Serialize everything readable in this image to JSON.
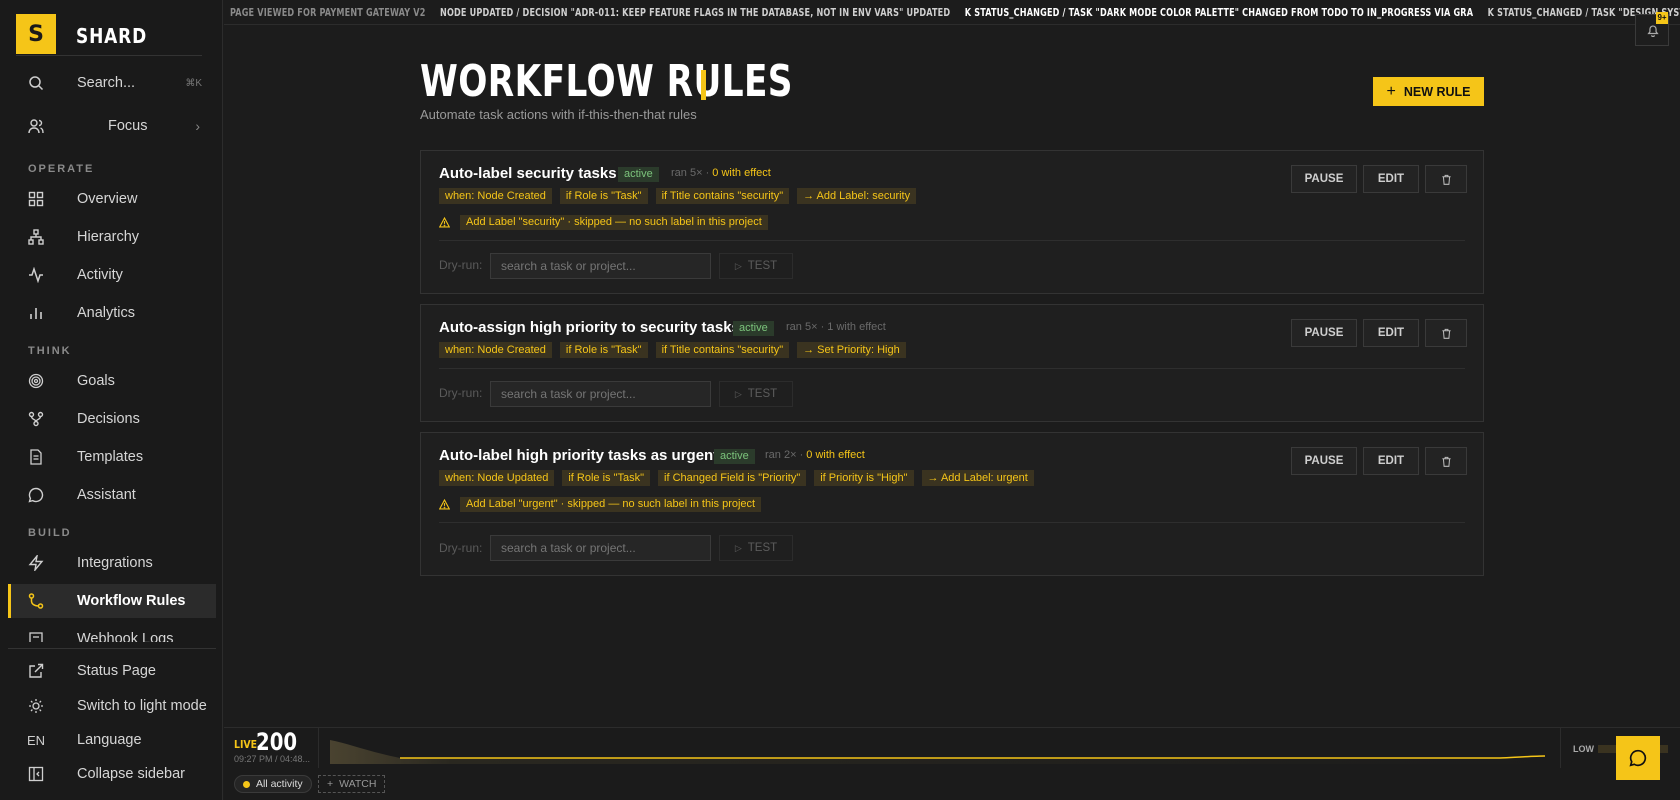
{
  "app": {
    "logo_letter": "S",
    "name": "SHARD"
  },
  "sidebar": {
    "search": {
      "label": "Search...",
      "shortcut": "⌘K"
    },
    "focus": {
      "label": "Focus"
    },
    "sections": {
      "operate": "OPERATE",
      "think": "THINK",
      "build": "BUILD"
    },
    "items": [
      {
        "label": "Overview"
      },
      {
        "label": "Hierarchy"
      },
      {
        "label": "Activity"
      },
      {
        "label": "Analytics"
      },
      {
        "label": "Goals"
      },
      {
        "label": "Decisions"
      },
      {
        "label": "Templates"
      },
      {
        "label": "Assistant"
      },
      {
        "label": "Integrations"
      },
      {
        "label": "Workflow Rules"
      },
      {
        "label": "Webhook Logs"
      }
    ],
    "bottom": [
      {
        "label": "Status Page"
      },
      {
        "label": "Switch to light mode"
      },
      {
        "prefix": "EN",
        "label": "Language"
      },
      {
        "label": "Collapse sidebar"
      }
    ]
  },
  "ticker": {
    "items": [
      "PAGE VIEWED FOR PAYMENT GATEWAY V2",
      "NODE UPDATED / DECISION \"ADR-011: KEEP FEATURE FLAGS IN THE DATABASE, NOT IN ENV VARS\" UPDATED",
      "K STATUS_CHANGED / TASK \"DARK MODE COLOR PALETTE\" CHANGED FROM TODO TO IN_PROGRESS VIA GRA",
      "K STATUS_CHANGED / TASK \"DESIGN SYSTEM TOKEN DEFINITIONS\" CHA"
    ],
    "badge": "9+"
  },
  "header": {
    "title": "WORKFLOW RULES",
    "subtitle": "Automate task actions with if-this-then-that rules",
    "new_rule_label": "NEW RULE"
  },
  "rules": [
    {
      "title": "Auto-label security tasks",
      "status": "active",
      "ran": "ran 5×",
      "effect": "0 with effect",
      "chips": [
        "when: Node Created",
        "if Role is \"Task\"",
        "if Title contains \"security\"",
        "→ Add Label: security"
      ],
      "warning": "Add Label \"security\" · skipped — no such label in this project"
    },
    {
      "title": "Auto-assign high priority to security tasks",
      "status": "active",
      "ran": "ran 5×",
      "effect": "1 with effect",
      "chips": [
        "when: Node Created",
        "if Role is \"Task\"",
        "if Title contains \"security\"",
        "→ Set Priority: High"
      ]
    },
    {
      "title": "Auto-label high priority tasks as urgent",
      "status": "active",
      "ran": "ran 2×",
      "effect": "0 with effect",
      "chips": [
        "when: Node Updated",
        "if Role is \"Task\"",
        "if Changed Field is \"Priority\"",
        "if Priority is \"High\"",
        "→ Add Label: urgent"
      ],
      "warning": "Add Label \"urgent\" · skipped — no such label in this project"
    }
  ],
  "card_actions": {
    "pause": "PAUSE",
    "edit": "EDIT"
  },
  "dry_run": {
    "label": "Dry-run:",
    "placeholder": "search a task or project...",
    "test": "TEST"
  },
  "live": {
    "label": "LIVE",
    "count": "200",
    "time": "09:27 PM / 04:48..."
  },
  "level": {
    "label": "LOW"
  },
  "activity_filter": {
    "all": "All activity",
    "watch": "WATCH"
  },
  "colors": {
    "accent": "#f5c518",
    "background": "#1c1c1c",
    "active_green": "#7cc47c"
  }
}
